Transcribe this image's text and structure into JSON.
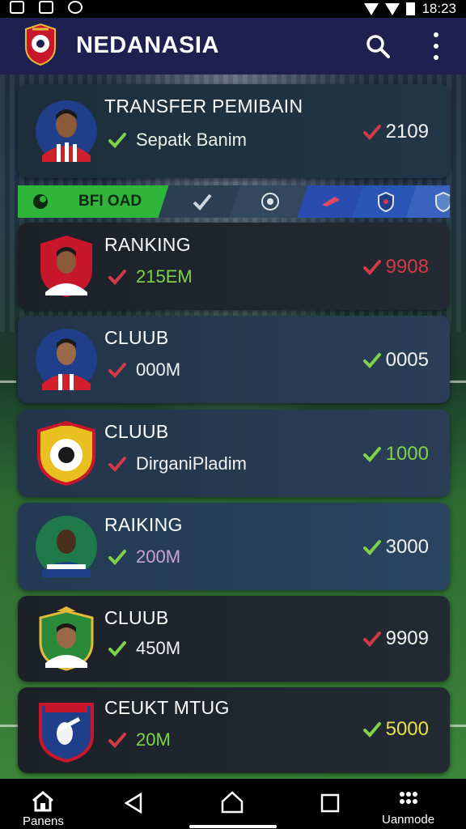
{
  "status_bar": {
    "time": "18:23"
  },
  "app_bar": {
    "title": "NEDANASIA",
    "logo_icon": "club-crest-icon"
  },
  "featured": {
    "title": "TRANSFER PEMIBAIN",
    "subtitle": "Sepatk Banim",
    "value": "2109",
    "subtitle_icon": "check-icon",
    "value_icon": "check-icon"
  },
  "filter_tabs": [
    {
      "label": "BFI OAD",
      "icon": "boot-icon",
      "active": true
    },
    {
      "label": "",
      "icon": "check-icon"
    },
    {
      "label": "",
      "icon": "ball-icon"
    },
    {
      "label": "",
      "icon": "boot-icon"
    },
    {
      "label": "",
      "icon": "shield-icon"
    },
    {
      "label": "",
      "icon": "shield-icon"
    }
  ],
  "list": [
    {
      "name": "RANKING",
      "sub": "215EM",
      "value": "9908",
      "value_color": "#d43a45",
      "sub_color": "#7fd34a",
      "sub_check": "#d43a45"
    },
    {
      "name": "CLUUB",
      "sub": "000M",
      "value": "0005",
      "value_color": "#f2f2f2",
      "sub_color": "#f2f2f2",
      "sub_check": "#d43a45"
    },
    {
      "name": "CLUUB",
      "sub": "DirganiPladim",
      "value": "1000",
      "value_color": "#7fd34a",
      "sub_color": "#f2f2f2",
      "sub_check": "#d43a45"
    },
    {
      "name": "RAIKING",
      "sub": "200M",
      "value": "3000",
      "value_color": "#f2f2f2",
      "sub_color": "#c9a3d6",
      "sub_check": "#7fd34a"
    },
    {
      "name": "CLUUB",
      "sub": "450M",
      "value": "9909",
      "value_color": "#f2f2f2",
      "sub_color": "#f2f2f2",
      "sub_check": "#7fd34a"
    },
    {
      "name": "CEUKT MTUG",
      "sub": "20M",
      "value": "5000",
      "value_color": "#e8e04a",
      "sub_color": "#7fd34a",
      "sub_check": "#d43a45"
    }
  ],
  "bottom_nav": {
    "left_label": "Panens",
    "right_label": "Uanmode"
  },
  "colors": {
    "accent_green": "#2fb53a",
    "app_bar": "#1e2150",
    "check_red": "#d43a45",
    "check_green": "#7fd34a"
  }
}
